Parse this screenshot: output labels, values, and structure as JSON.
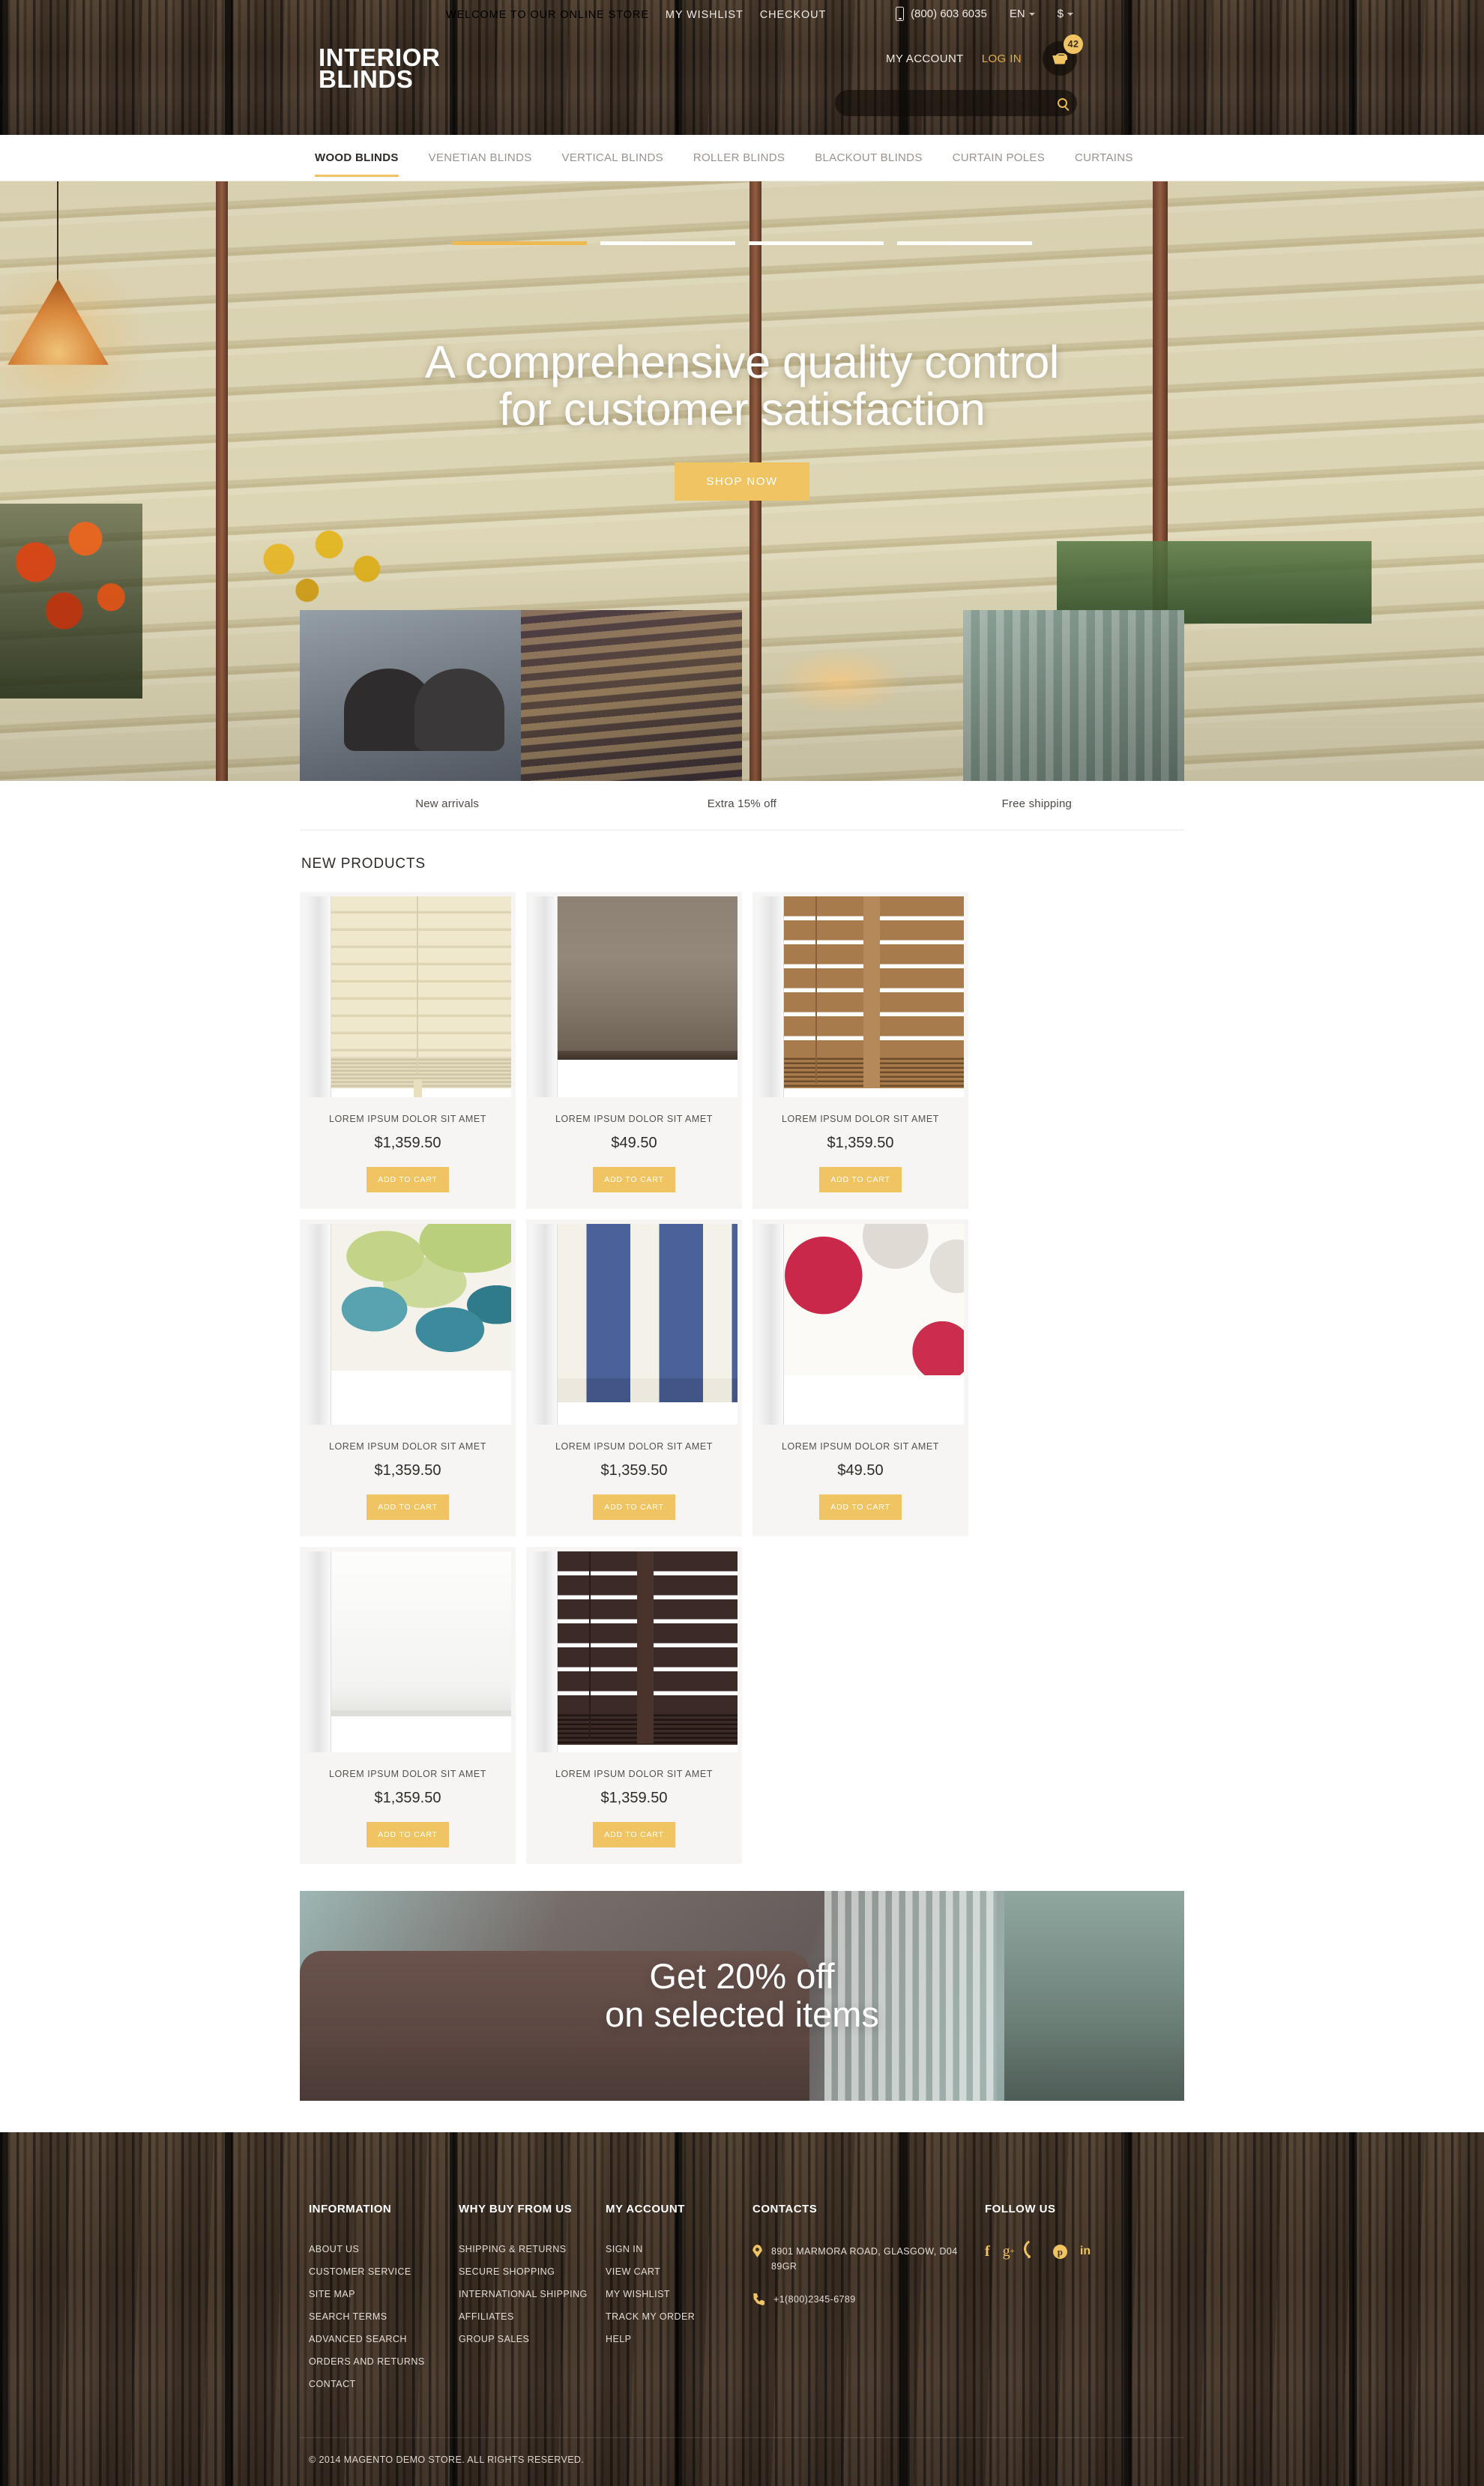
{
  "topbar": {
    "welcome": "WELCOME TO OUR ONLINE STORE",
    "wishlist": "MY WISHLIST",
    "checkout": "CHECKOUT",
    "phone": "(800) 603 6035",
    "language": "EN",
    "currency": "$",
    "my_account": "MY ACCOUNT",
    "log_in": "LOG IN",
    "cart_count": "42"
  },
  "brand": {
    "line1": "INTERIOR",
    "line2": "BLINDS"
  },
  "search": {
    "value": "",
    "placeholder": ""
  },
  "nav": {
    "items": [
      {
        "label": "WOOD BLINDS",
        "active": true
      },
      {
        "label": "VENETIAN BLINDS",
        "active": false
      },
      {
        "label": "VERTICAL BLINDS",
        "active": false
      },
      {
        "label": "ROLLER BLINDS",
        "active": false
      },
      {
        "label": "BLACKOUT BLINDS",
        "active": false
      },
      {
        "label": "CURTAIN POLES",
        "active": false
      },
      {
        "label": "CURTAINS",
        "active": false
      }
    ]
  },
  "hero": {
    "title_line1": "A comprehensive quality control",
    "title_line2": "for customer satisfaction",
    "cta": "SHOP NOW",
    "slide_count": 4,
    "active_slide": 1
  },
  "promos": [
    {
      "caption": "New arrivals"
    },
    {
      "caption": "Extra 15% off"
    },
    {
      "caption": "Free shipping"
    }
  ],
  "products_section": {
    "title": "NEW PRODUCTS",
    "add_to_cart": "ADD TO CART",
    "items": [
      {
        "name": "LOREM IPSUM DOLOR SIT AMET",
        "price": "$1,359.50",
        "style": "p-cream"
      },
      {
        "name": "LOREM IPSUM DOLOR SIT AMET",
        "price": "$49.50",
        "style": "p-taupe"
      },
      {
        "name": "LOREM IPSUM DOLOR SIT AMET",
        "price": "$1,359.50",
        "style": "p-wood"
      },
      {
        "name": "LOREM IPSUM DOLOR SIT AMET",
        "price": "$1,359.50",
        "style": "p-leaf"
      },
      {
        "name": "LOREM IPSUM DOLOR SIT AMET",
        "price": "$1,359.50",
        "style": "p-stripe"
      },
      {
        "name": "LOREM IPSUM DOLOR SIT AMET",
        "price": "$49.50",
        "style": "p-floral"
      },
      {
        "name": "LOREM IPSUM DOLOR SIT AMET",
        "price": "$1,359.50",
        "style": "p-white"
      },
      {
        "name": "LOREM IPSUM DOLOR SIT AMET",
        "price": "$1,359.50",
        "style": "p-dark"
      }
    ]
  },
  "banner": {
    "line1": "Get 20% off",
    "line2": "on selected items"
  },
  "footer": {
    "columns": [
      {
        "heading": "INFORMATION",
        "links": [
          "ABOUT US",
          "CUSTOMER SERVICE",
          "SITE MAP",
          "SEARCH TERMS",
          "ADVANCED SEARCH",
          "ORDERS AND RETURNS",
          "CONTACT"
        ]
      },
      {
        "heading": "WHY BUY FROM US",
        "links": [
          "SHIPPING & RETURNS",
          "SECURE SHOPPING",
          "INTERNATIONAL SHIPPING",
          "AFFILIATES",
          "GROUP SALES"
        ]
      },
      {
        "heading": "MY ACCOUNT",
        "links": [
          "SIGN IN",
          "VIEW CART",
          "MY WISHLIST",
          "TRACK MY ORDER",
          "HELP"
        ]
      }
    ],
    "contacts": {
      "heading": "CONTACTS",
      "address": "8901 MARMORA ROAD, GLASGOW, D04 89GR",
      "phone": "+1(800)2345-6789"
    },
    "follow": {
      "heading": "FOLLOW US",
      "icons": [
        "facebook-icon",
        "google-plus-icon",
        "rss-icon",
        "pinterest-icon",
        "linkedin-icon"
      ]
    },
    "copyright": "© 2014 MAGENTO DEMO STORE. ALL RIGHTS RESERVED."
  },
  "colors": {
    "accent": "#f0c462",
    "wood": "#46382c",
    "text_dark": "#2e2a26"
  }
}
